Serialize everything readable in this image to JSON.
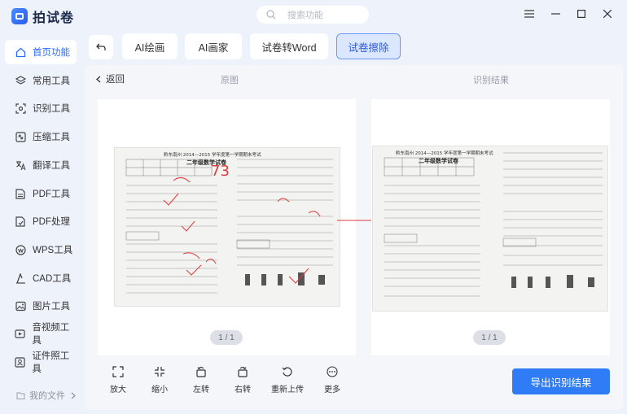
{
  "app": {
    "name": "拍试卷"
  },
  "search": {
    "placeholder": "搜索功能"
  },
  "sidebar": {
    "items": [
      {
        "label": "首页功能",
        "icon": "home-icon",
        "active": true
      },
      {
        "label": "常用工具",
        "icon": "layers-icon"
      },
      {
        "label": "识别工具",
        "icon": "scan-icon"
      },
      {
        "label": "压缩工具",
        "icon": "compress-icon"
      },
      {
        "label": "翻译工具",
        "icon": "translate-icon"
      },
      {
        "label": "PDF工具",
        "icon": "pdf-icon"
      },
      {
        "label": "PDF处理",
        "icon": "pdf-process-icon"
      },
      {
        "label": "WPS工具",
        "icon": "wps-icon"
      },
      {
        "label": "CAD工具",
        "icon": "cad-icon"
      },
      {
        "label": "图片工具",
        "icon": "image-icon"
      },
      {
        "label": "音视频工具",
        "icon": "video-icon"
      },
      {
        "label": "证件照工具",
        "icon": "id-photo-icon"
      }
    ],
    "my_files": "我的文件"
  },
  "tabs": [
    {
      "label": "AI绘画"
    },
    {
      "label": "AI画家"
    },
    {
      "label": "试卷转Word"
    },
    {
      "label": "试卷擦除",
      "active": true
    }
  ],
  "view": {
    "back_label": "返回",
    "original_label": "原图",
    "result_label": "识别结果",
    "left_pager": "1 / 1",
    "right_pager": "1 / 1"
  },
  "doc": {
    "header_line": "黔东南州 2014—2015 学年度第一学期期末考试",
    "title": "二年级数学试卷",
    "score": "73"
  },
  "toolbar": {
    "items": [
      {
        "label": "放大",
        "icon": "zoom-in-icon"
      },
      {
        "label": "缩小",
        "icon": "zoom-out-icon"
      },
      {
        "label": "左转",
        "icon": "rotate-left-icon"
      },
      {
        "label": "右转",
        "icon": "rotate-right-icon"
      },
      {
        "label": "重新上传",
        "icon": "reupload-icon"
      },
      {
        "label": "更多",
        "icon": "more-icon"
      }
    ],
    "export_label": "导出识别结果"
  }
}
